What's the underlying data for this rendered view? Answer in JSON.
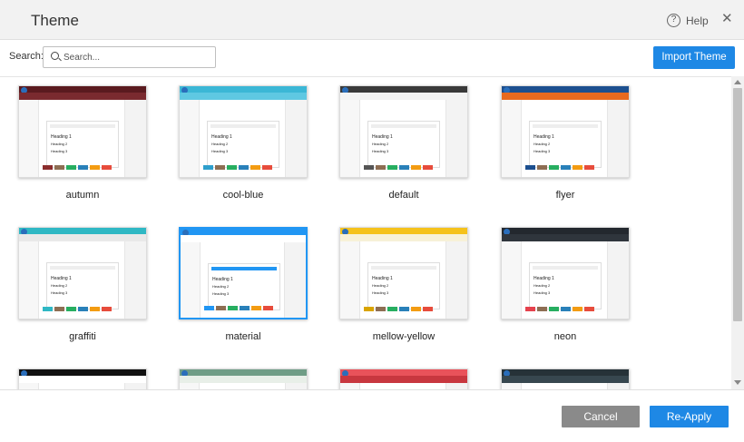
{
  "dialog": {
    "title": "Theme",
    "help_label": "Help",
    "help_icon_glyph": "?",
    "close_icon_glyph": "✕"
  },
  "search": {
    "label": "Search:",
    "placeholder": "Search...",
    "value": ""
  },
  "toolbar": {
    "import_label": "Import Theme"
  },
  "themes": [
    {
      "name": "autumn",
      "top": "#5a1a1f",
      "nav": "#7a2a2f",
      "accent": "#8b2d2d",
      "selected": false
    },
    {
      "name": "cool-blue",
      "top": "#3bb7d6",
      "nav": "#5fc8e2",
      "accent": "#2e9fcc",
      "selected": false
    },
    {
      "name": "default",
      "top": "#3a3a3a",
      "nav": "#f4f4f4",
      "accent": "#555555",
      "selected": false
    },
    {
      "name": "flyer",
      "top": "#1c4f8f",
      "nav": "#e86a1f",
      "accent": "#1c4f8f",
      "selected": false
    },
    {
      "name": "graffiti",
      "top": "#2fb8c4",
      "nav": "#e9e9e9",
      "accent": "#2fb8c4",
      "selected": false
    },
    {
      "name": "material",
      "top": "#2196f3",
      "nav": "#ffffff",
      "accent": "#2196f3",
      "selected": true
    },
    {
      "name": "mellow-yellow",
      "top": "#f5c21b",
      "nav": "#f7f1d8",
      "accent": "#d9a400",
      "selected": false
    },
    {
      "name": "neon",
      "top": "#23282e",
      "nav": "#2f353c",
      "accent": "#e5424d",
      "selected": false
    },
    {
      "name": "",
      "top": "#111111",
      "nav": "#ffffff",
      "accent": "#444444",
      "selected": false
    },
    {
      "name": "",
      "top": "#6f9d86",
      "nav": "#e8efe8",
      "accent": "#6f9d86",
      "selected": false
    },
    {
      "name": "",
      "top": "#e9525a",
      "nav": "#c8373f",
      "accent": "#e9525a",
      "selected": false
    },
    {
      "name": "",
      "top": "#263238",
      "nav": "#37474f",
      "accent": "#1e6e5f",
      "selected": false
    }
  ],
  "preview_text": {
    "heading1": "Heading 1",
    "heading2": "Heading 2",
    "heading3": "Heading 3"
  },
  "footer": {
    "cancel_label": "Cancel",
    "reapply_label": "Re-Apply"
  }
}
